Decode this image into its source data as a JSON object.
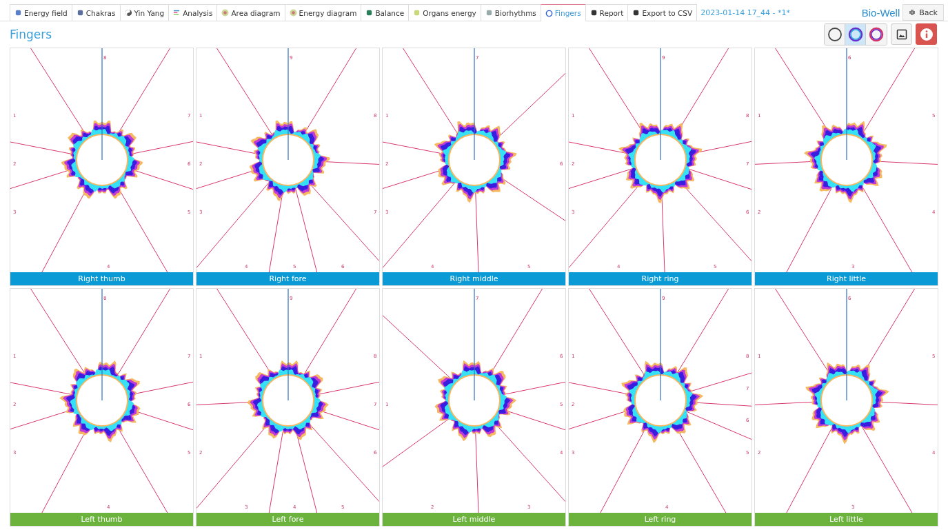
{
  "tabs": [
    {
      "label": "Energy field",
      "selected": false
    },
    {
      "label": "Chakras",
      "selected": false
    },
    {
      "label": "Yin Yang",
      "selected": false
    },
    {
      "label": "Analysis",
      "selected": false
    },
    {
      "label": "Area diagram",
      "selected": false
    },
    {
      "label": "Energy diagram",
      "selected": false
    },
    {
      "label": "Balance",
      "selected": false
    },
    {
      "label": "Organs energy",
      "selected": false
    },
    {
      "label": "Biorhythms",
      "selected": false
    },
    {
      "label": "Fingers",
      "selected": true
    },
    {
      "label": "Report",
      "selected": false
    },
    {
      "label": "Export to CSV",
      "selected": false
    }
  ],
  "session": "2023-01-14 17_44 - *1*",
  "logo": "Bio-Well",
  "back_button": "Back",
  "page_title": "Fingers",
  "view_modes": [
    {
      "kind": "plain",
      "selected": false
    },
    {
      "kind": "color",
      "selected": true
    },
    {
      "kind": "filtered",
      "selected": false
    }
  ],
  "panels": [
    {
      "name": "Right thumb",
      "color": "#0a9bd6",
      "top_sector": "8",
      "left_sectors": [
        "1",
        "2",
        "3"
      ],
      "bottom_sectors": [
        "4"
      ],
      "right_sectors": [
        "7",
        "6",
        "5"
      ]
    },
    {
      "name": "Right fore",
      "color": "#0a9bd6",
      "top_sector": "9",
      "left_sectors": [
        "1",
        "2",
        "3"
      ],
      "bottom_sectors": [
        "4",
        "5",
        "6"
      ],
      "right_sectors": [
        "8",
        "7"
      ]
    },
    {
      "name": "Right middle",
      "color": "#0a9bd6",
      "top_sector": "7",
      "left_sectors": [
        "1",
        "2",
        "3"
      ],
      "bottom_sectors": [
        "4",
        "5"
      ],
      "right_sectors": [
        "6"
      ]
    },
    {
      "name": "Right ring",
      "color": "#0a9bd6",
      "top_sector": "9",
      "left_sectors": [
        "1",
        "2",
        "3"
      ],
      "bottom_sectors": [
        "4",
        "5"
      ],
      "right_sectors": [
        "8",
        "7",
        "6"
      ]
    },
    {
      "name": "Right little",
      "color": "#0a9bd6",
      "top_sector": "6",
      "left_sectors": [
        "1",
        "2"
      ],
      "bottom_sectors": [
        "3"
      ],
      "right_sectors": [
        "5",
        "4"
      ]
    },
    {
      "name": "Left thumb",
      "color": "#6cb33e",
      "top_sector": "8",
      "left_sectors": [
        "1",
        "2",
        "3"
      ],
      "bottom_sectors": [
        "4"
      ],
      "right_sectors": [
        "7",
        "6",
        "5"
      ]
    },
    {
      "name": "Left fore",
      "color": "#6cb33e",
      "top_sector": "9",
      "left_sectors": [
        "1",
        "2"
      ],
      "bottom_sectors": [
        "3",
        "4",
        "5"
      ],
      "right_sectors": [
        "8",
        "7",
        "6"
      ]
    },
    {
      "name": "Left middle",
      "color": "#6cb33e",
      "top_sector": "7",
      "left_sectors": [
        "1"
      ],
      "bottom_sectors": [
        "2",
        "3"
      ],
      "right_sectors": [
        "6",
        "5",
        "4"
      ]
    },
    {
      "name": "Left ring",
      "color": "#6cb33e",
      "top_sector": "9",
      "left_sectors": [
        "1",
        "2",
        "3"
      ],
      "bottom_sectors": [
        "4"
      ],
      "right_sectors": [
        "8",
        "7",
        "6",
        "5"
      ]
    },
    {
      "name": "Left little",
      "color": "#6cb33e",
      "top_sector": "6",
      "left_sectors": [
        "1",
        "2"
      ],
      "bottom_sectors": [
        "3"
      ],
      "right_sectors": [
        "5",
        "4"
      ]
    }
  ]
}
